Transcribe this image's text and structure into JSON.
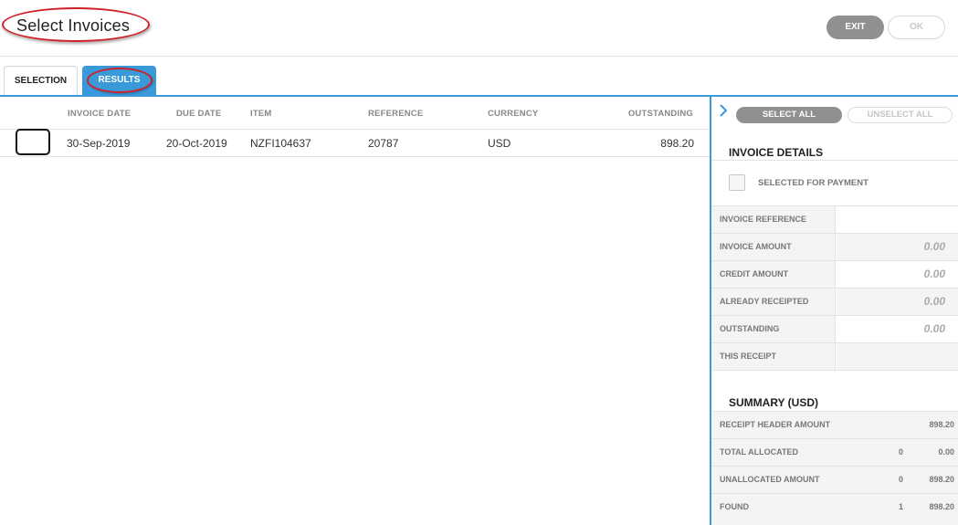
{
  "header": {
    "title": "Select Invoices",
    "exit_label": "EXIT",
    "ok_label": "OK"
  },
  "tabs": [
    {
      "label": "SELECTION",
      "active": false
    },
    {
      "label": "RESULTS",
      "active": true
    }
  ],
  "table": {
    "columns": [
      "INVOICE DATE",
      "DUE DATE",
      "ITEM",
      "REFERENCE",
      "CURRENCY",
      "OUTSTANDING"
    ],
    "rows": [
      {
        "invoice_date": "30-Sep-2019",
        "due_date": "20-Oct-2019",
        "item": "NZFI104637",
        "reference": "20787",
        "currency": "USD",
        "outstanding": "898.20",
        "selected": false
      }
    ]
  },
  "panel": {
    "select_all_label": "SELECT ALL",
    "unselect_all_label": "UNSELECT ALL",
    "invoice_details_title": "INVOICE DETAILS",
    "selected_for_payment_label": "SELECTED FOR PAYMENT",
    "details": [
      {
        "label": "INVOICE REFERENCE",
        "value": ""
      },
      {
        "label": "INVOICE AMOUNT",
        "value": "0.00"
      },
      {
        "label": "CREDIT AMOUNT",
        "value": "0.00"
      },
      {
        "label": "ALREADY RECEIPTED",
        "value": "0.00"
      },
      {
        "label": "OUTSTANDING",
        "value": "0.00"
      },
      {
        "label": "THIS RECEIPT",
        "value": ""
      }
    ],
    "summary_title": "SUMMARY (USD)",
    "summary": [
      {
        "label": "RECEIPT HEADER AMOUNT",
        "count": "",
        "amount": "898.20"
      },
      {
        "label": "TOTAL ALLOCATED",
        "count": "0",
        "amount": "0.00"
      },
      {
        "label": "UNALLOCATED AMOUNT",
        "count": "0",
        "amount": "898.20"
      },
      {
        "label": "FOUND",
        "count": "1",
        "amount": "898.20"
      }
    ]
  },
  "colors": {
    "accent": "#3a9ad9",
    "annotation": "#d0212a",
    "button_gray": "#8e9092"
  }
}
